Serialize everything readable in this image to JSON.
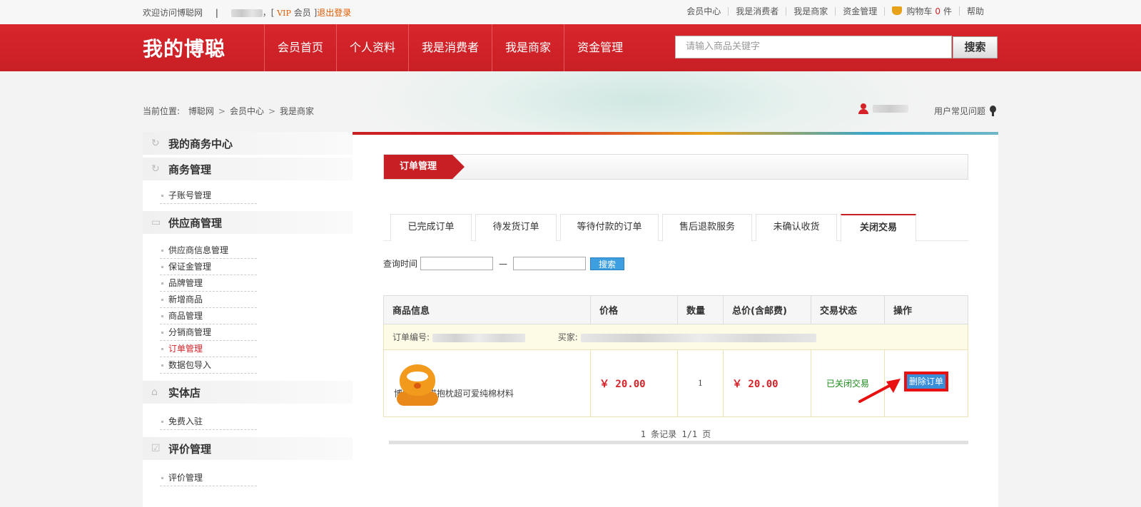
{
  "topbar": {
    "welcome": "欢迎访问博聪网",
    "separator": "|",
    "comma_bracket": "，[",
    "vip": "VIP",
    "member": "会员",
    "close_bracket": "]",
    "logout": "退出登录",
    "links": [
      "会员中心",
      "我是消费者",
      "我是商家",
      "资金管理"
    ],
    "cart_label": "购物车",
    "cart_count": "0",
    "cart_unit": "件",
    "help": "帮助"
  },
  "header": {
    "logo": "我的博聪",
    "nav": [
      "会员首页",
      "个人资料",
      "我是消费者",
      "我是商家",
      "资金管理"
    ],
    "search_placeholder": "请输入商品关键字",
    "search_button": "搜索"
  },
  "breadcrumb": {
    "prefix": "当前位置:",
    "items": [
      "博聪网",
      "会员中心",
      "我是商家"
    ],
    "arrow": ">"
  },
  "faq": "用户常见问题",
  "sidebar": {
    "sections": [
      {
        "title": "我的商务中心",
        "icon": "refresh-icon",
        "items": []
      },
      {
        "title": "商务管理",
        "icon": "refresh-icon",
        "items": [
          "子账号管理"
        ]
      },
      {
        "title": "供应商管理",
        "icon": "card-icon",
        "items": [
          "供应商信息管理",
          "保证金管理",
          "品牌管理",
          "新增商品",
          "商品管理",
          "分销商管理",
          "订单管理",
          "数据包导入"
        ]
      },
      {
        "title": "实体店",
        "icon": "store-icon",
        "items": [
          "免费入驻"
        ]
      },
      {
        "title": "评价管理",
        "icon": "check-icon",
        "items": [
          "评价管理"
        ]
      }
    ],
    "active_item": "订单管理"
  },
  "main": {
    "title": "订单管理",
    "tabs": [
      "已完成订单",
      "待发货订单",
      "等待付款的订单",
      "售后退款服务",
      "未确认收货",
      "关闭交易"
    ],
    "active_tab": "关闭交易",
    "query_label": "查询时间",
    "query_dash": "—",
    "query_button": "搜索",
    "table": {
      "headers": [
        "商品信息",
        "价格",
        "数量",
        "总价(含邮费)",
        "交易状态",
        "操作"
      ],
      "order_no_label": "订单编号:",
      "buyer_label": "买家:",
      "product_name": "博聪加菲猫抱枕超可爱纯棉材料",
      "price": "￥ 20.00",
      "quantity": "1",
      "total": "￥ 20.00",
      "status": "已关闭交易",
      "action": "删除订单"
    },
    "pager": "1 条记录 1/1 页"
  },
  "colors": {
    "brand_red": "#c81f25",
    "status_green": "#1a8a1a",
    "highlight_red": "#e81010"
  }
}
